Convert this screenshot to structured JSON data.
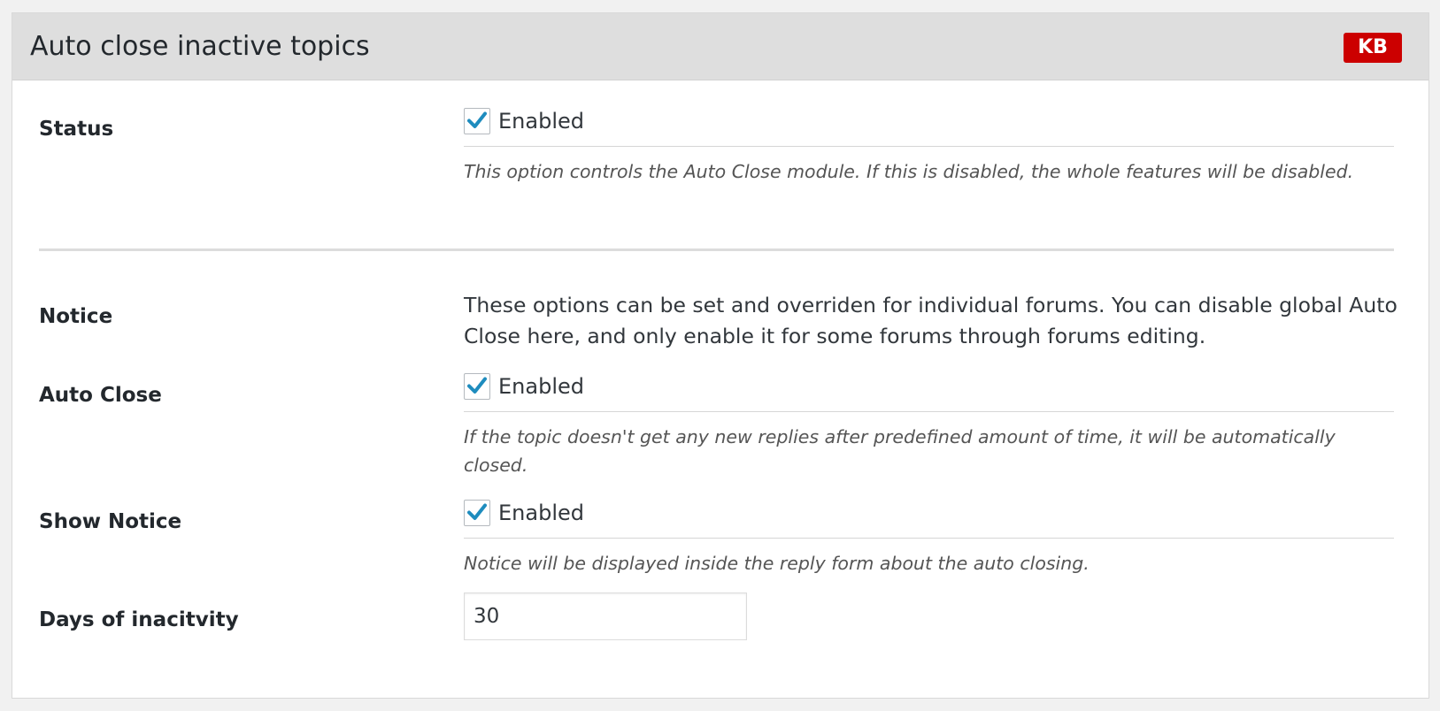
{
  "panel": {
    "title": "Auto close inactive topics",
    "badge": "KB",
    "badge_color": "#cc0000"
  },
  "status": {
    "label": "Status",
    "checkbox_label": "Enabled",
    "checked": true,
    "description": "This option controls the Auto Close module. If this is disabled, the whole features will be disabled."
  },
  "notice": {
    "label": "Notice",
    "text": "These options can be set and overriden for individual forums. You can disable global Auto Close here, and only enable it for some forums through forums editing."
  },
  "auto_close": {
    "label": "Auto Close",
    "checkbox_label": "Enabled",
    "checked": true,
    "description": "If the topic doesn't get any new replies after predefined amount of time, it will be automatically closed."
  },
  "show_notice": {
    "label": "Show Notice",
    "checkbox_label": "Enabled",
    "checked": true,
    "description": "Notice will be displayed inside the reply form about the auto closing."
  },
  "days": {
    "label": "Days of inacitvity",
    "value": "30"
  },
  "check_icon": "checkmark-icon",
  "check_color": "#1e8cbe"
}
